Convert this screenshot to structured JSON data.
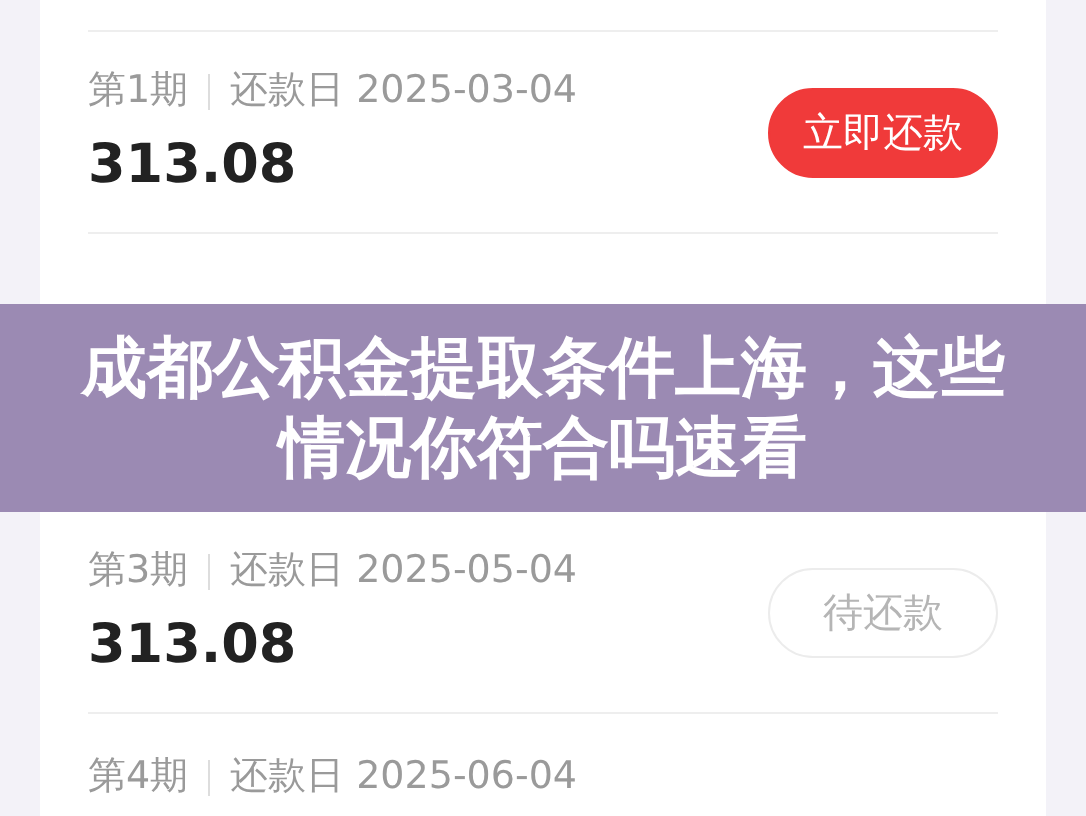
{
  "installments_top": [
    {
      "period": "第1期",
      "date_label": "还款日",
      "date": "2025-03-04",
      "amount": "313.08",
      "action": {
        "label": "立即还款",
        "kind": "primary"
      }
    }
  ],
  "banner": {
    "title": "成都公积金提取条件上海，这些情况你符合吗速看"
  },
  "installments_bottom": [
    {
      "period": "第3期",
      "date_label": "还款日",
      "date": "2025-05-04",
      "amount": "313.08",
      "action": {
        "label": "待还款",
        "kind": "pending"
      }
    },
    {
      "period": "第4期",
      "date_label": "还款日",
      "date": "2025-06-04"
    }
  ]
}
